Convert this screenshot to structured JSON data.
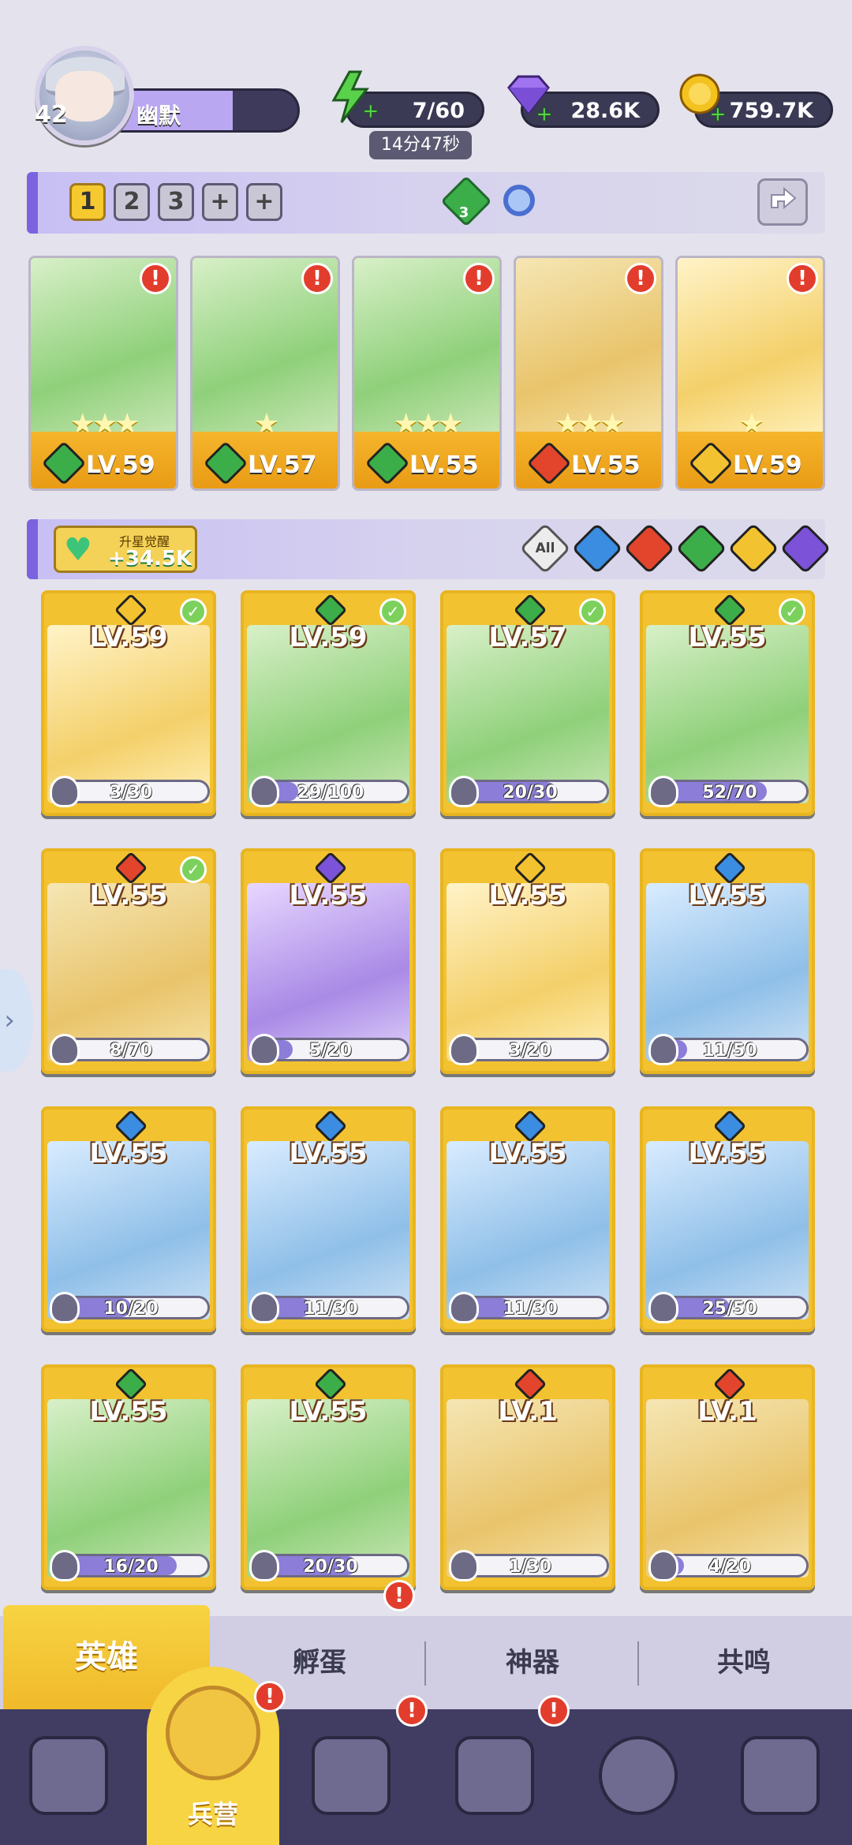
{
  "profile": {
    "level": "42",
    "name": "幽默"
  },
  "resources": {
    "energy": {
      "value": "7/60",
      "timer": "14分47秒",
      "icon": "lightning-icon"
    },
    "gems": {
      "value": "28.6K",
      "icon": "diamond-icon"
    },
    "gold": {
      "value": "759.7K",
      "icon": "coin-icon"
    }
  },
  "team_bar": {
    "tabs": [
      "1",
      "2",
      "3",
      "+",
      "+"
    ],
    "active_tab": "1",
    "badge_count": "3"
  },
  "team": [
    {
      "level": "LV.59",
      "element": "wind",
      "stars": 3,
      "alert": "!"
    },
    {
      "level": "LV.57",
      "element": "wind",
      "stars": 1,
      "alert": "!"
    },
    {
      "level": "LV.55",
      "element": "wind",
      "stars": 3,
      "alert": "!"
    },
    {
      "level": "LV.55",
      "element": "fire",
      "stars": 3,
      "alert": "!"
    },
    {
      "level": "LV.59",
      "element": "light",
      "stars": 1,
      "alert": "!"
    }
  ],
  "awaken": {
    "label": "升星觉醒",
    "value": "+34.5K"
  },
  "filters": {
    "all_label": "All",
    "elements": [
      "water",
      "fire",
      "wind",
      "light",
      "dark"
    ]
  },
  "heroes": [
    {
      "level": "LV.59",
      "element": "light",
      "checked": true,
      "shards": "3/30",
      "progress": 0.1
    },
    {
      "level": "LV.59",
      "element": "wind",
      "checked": true,
      "shards": "29/100",
      "progress": 0.29
    },
    {
      "level": "LV.57",
      "element": "wind",
      "checked": true,
      "shards": "20/30",
      "progress": 0.67
    },
    {
      "level": "LV.55",
      "element": "wind",
      "checked": true,
      "shards": "52/70",
      "progress": 0.74
    },
    {
      "level": "LV.55",
      "element": "fire",
      "checked": true,
      "shards": "8/70",
      "progress": 0.11
    },
    {
      "level": "LV.55",
      "element": "dark",
      "checked": false,
      "shards": "5/20",
      "progress": 0.25
    },
    {
      "level": "LV.55",
      "element": "light",
      "checked": false,
      "shards": "3/20",
      "progress": 0.15
    },
    {
      "level": "LV.55",
      "element": "water",
      "checked": false,
      "shards": "11/50",
      "progress": 0.22
    },
    {
      "level": "LV.55",
      "element": "water",
      "checked": false,
      "shards": "10/20",
      "progress": 0.5
    },
    {
      "level": "LV.55",
      "element": "water",
      "checked": false,
      "shards": "11/30",
      "progress": 0.37
    },
    {
      "level": "LV.55",
      "element": "water",
      "checked": false,
      "shards": "11/30",
      "progress": 0.37
    },
    {
      "level": "LV.55",
      "element": "water",
      "checked": false,
      "shards": "25/50",
      "progress": 0.5
    },
    {
      "level": "LV.55",
      "element": "wind",
      "checked": false,
      "shards": "16/20",
      "progress": 0.8
    },
    {
      "level": "LV.55",
      "element": "wind",
      "checked": false,
      "shards": "20/30",
      "progress": 0.67
    },
    {
      "level": "LV.1",
      "element": "fire",
      "checked": false,
      "shards": "1/30",
      "progress": 0.03
    },
    {
      "level": "LV.1",
      "element": "fire",
      "checked": false,
      "shards": "4/20",
      "progress": 0.2
    }
  ],
  "sub_tabs": [
    {
      "label": "英雄",
      "active": true,
      "alert": false
    },
    {
      "label": "孵蛋",
      "active": false,
      "alert": true
    },
    {
      "label": "神器",
      "active": false,
      "alert": false
    },
    {
      "label": "共鸣",
      "active": false,
      "alert": false
    }
  ],
  "main_nav": [
    {
      "label": "",
      "icon": "cards-icon",
      "alert": false
    },
    {
      "label": "兵营",
      "icon": "barracks-icon",
      "alert": true,
      "active": true
    },
    {
      "label": "",
      "icon": "map-icon",
      "alert": true
    },
    {
      "label": "",
      "icon": "castle-icon",
      "alert": true
    },
    {
      "label": "",
      "icon": "mushroom-icon",
      "alert": false
    },
    {
      "label": "",
      "icon": "guild-banner-icon",
      "alert": false
    }
  ],
  "colors": {
    "wind": "#3cae49",
    "fire": "#e2452c",
    "water": "#3a8de0",
    "light": "#f2c230",
    "dark": "#7b52d8",
    "accent": "#7b63e0",
    "gold": "#f2c230"
  }
}
